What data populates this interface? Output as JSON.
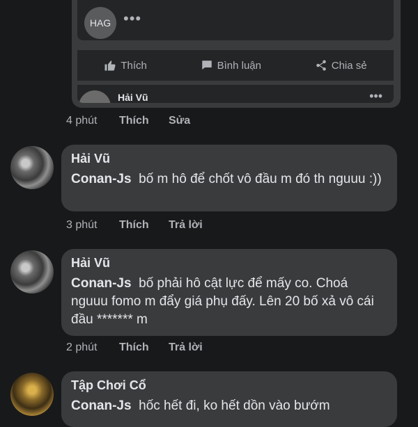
{
  "shared_post": {
    "page_avatar_text": "HAG",
    "more_label": "•••",
    "actions": [
      {
        "label": "Thích",
        "icon": "thumbs-up-icon"
      },
      {
        "label": "Bình luận",
        "icon": "comment-icon"
      },
      {
        "label": "Chia sẻ",
        "icon": "share-icon"
      }
    ],
    "peek_author": "Hải Vũ",
    "peek_more": "•••"
  },
  "post_meta": {
    "time": "4 phút",
    "like": "Thích",
    "edit": "Sửa"
  },
  "comments": [
    {
      "author": "Hải Vũ",
      "mention": "Conan-Js",
      "text": "bố m hô để chốt vô đầu m đó th nguuu :))",
      "time": "3 phút",
      "like": "Thích",
      "reply": "Trả lời"
    },
    {
      "author": "Hải Vũ",
      "mention": "Conan-Js",
      "text": "bố phải hô cật lực để mấy co. Choá nguuu fomo m đẩy giá phụ đấy. Lên 20 bố xả vô cái đầu ******* m",
      "time": "2 phút",
      "like": "Thích",
      "reply": "Trả lời"
    },
    {
      "author": "Tập Chơi Cổ",
      "mention": "Conan-Js",
      "text": "hốc hết đi, ko hết dồn vào bướm"
    }
  ]
}
